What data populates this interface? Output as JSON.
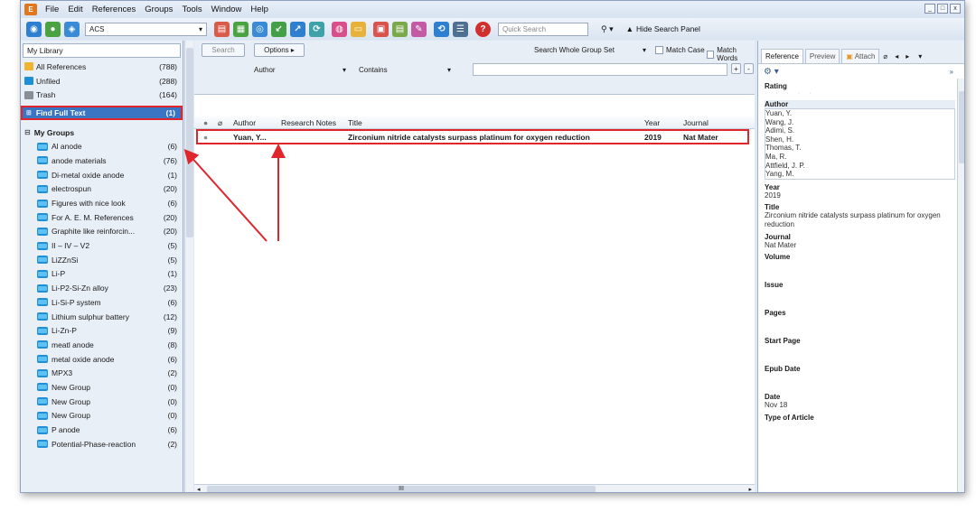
{
  "menu": [
    {
      "label": "File"
    },
    {
      "label": "Edit"
    },
    {
      "label": "References"
    },
    {
      "label": "Groups"
    },
    {
      "label": "Tools"
    },
    {
      "label": "Window"
    },
    {
      "label": "Help"
    }
  ],
  "window_controls": [
    "_",
    "□",
    "x"
  ],
  "toolbar": {
    "style_value": "ACS",
    "quick_search_placeholder": "Quick Search",
    "hide_search_panel": "Hide Search Panel"
  },
  "library": {
    "header": "My Library",
    "items": [
      {
        "label": "All References",
        "count": "(788)"
      },
      {
        "label": "Unfiled",
        "count": "(288)"
      },
      {
        "label": "Trash",
        "count": "(164)"
      },
      {
        "label": "Find Full Text",
        "count": "(1)"
      }
    ],
    "groups_header": "My Groups",
    "groups": [
      {
        "label": "Al anode",
        "count": "(6)"
      },
      {
        "label": "anode materials",
        "count": "(76)"
      },
      {
        "label": "Di-metal oxide anode",
        "count": "(1)"
      },
      {
        "label": "electrospun",
        "count": "(20)"
      },
      {
        "label": "Figures with nice look",
        "count": "(6)"
      },
      {
        "label": "For A. E. M. References",
        "count": "(20)"
      },
      {
        "label": "Graphite like reinforcin...",
        "count": "(20)"
      },
      {
        "label": "II – IV – V2",
        "count": "(5)"
      },
      {
        "label": "LiZZnSi",
        "count": "(5)"
      },
      {
        "label": "Li-P",
        "count": "(1)"
      },
      {
        "label": "Li-P2-Si-Zn alloy",
        "count": "(23)"
      },
      {
        "label": "Li-Si-P system",
        "count": "(6)"
      },
      {
        "label": "Lithium sulphur battery",
        "count": "(12)"
      },
      {
        "label": "Li-Zn-P",
        "count": "(9)"
      },
      {
        "label": "meatl anode",
        "count": "(8)"
      },
      {
        "label": "metal oxide anode",
        "count": "(6)"
      },
      {
        "label": "MPX3",
        "count": "(2)"
      },
      {
        "label": "New Group",
        "count": "(0)"
      },
      {
        "label": "New Group",
        "count": "(0)"
      },
      {
        "label": "New Group",
        "count": "(0)"
      },
      {
        "label": "P anode",
        "count": "(6)"
      },
      {
        "label": "Potential-Phase-reaction",
        "count": "(2)"
      }
    ]
  },
  "search": {
    "search_btn": "Search",
    "options_btn": "Options ▸",
    "scope": "Search Whole Group Set",
    "match_case": "Match Case",
    "match_words": "Match Words",
    "field": "Author",
    "operator": "Contains",
    "value": ""
  },
  "table": {
    "headers": {
      "author": "Author",
      "notes": "Research Notes",
      "title": "Title",
      "year": "Year",
      "journal": "Journal"
    },
    "rows": [
      {
        "author": "Yuan, Y...",
        "notes": "",
        "title": "Zirconium nitride catalysts surpass platinum for oxygen reduction",
        "year": "2019",
        "journal": "Nat Mater"
      }
    ],
    "hscroll_label": "III"
  },
  "reference_panel": {
    "tabs": [
      "Reference",
      "Preview",
      "Attach"
    ],
    "fields": {
      "rating_label": "Rating",
      "author_label": "Author",
      "authors": [
        "Yuan, Y.",
        "Wang, J.",
        "Adimi, S.",
        "Shen, H.",
        "Thomas, T.",
        "Ma, R.",
        "Attfield, J. P.",
        "Yang, M."
      ],
      "year_label": "Year",
      "year": "2019",
      "title_label": "Title",
      "title": "Zirconium nitride catalysts surpass platinum for oxygen reduction",
      "journal_label": "Journal",
      "journal": "Nat Mater",
      "volume_label": "Volume",
      "issue_label": "Issue",
      "pages_label": "Pages",
      "start_page_label": "Start Page",
      "epub_label": "Epub Date",
      "date_label": "Date",
      "date": "Nov 18",
      "type_label": "Type of Article"
    }
  },
  "colors": {
    "highlight": "#e0252b",
    "selection": "#3a75c4"
  }
}
